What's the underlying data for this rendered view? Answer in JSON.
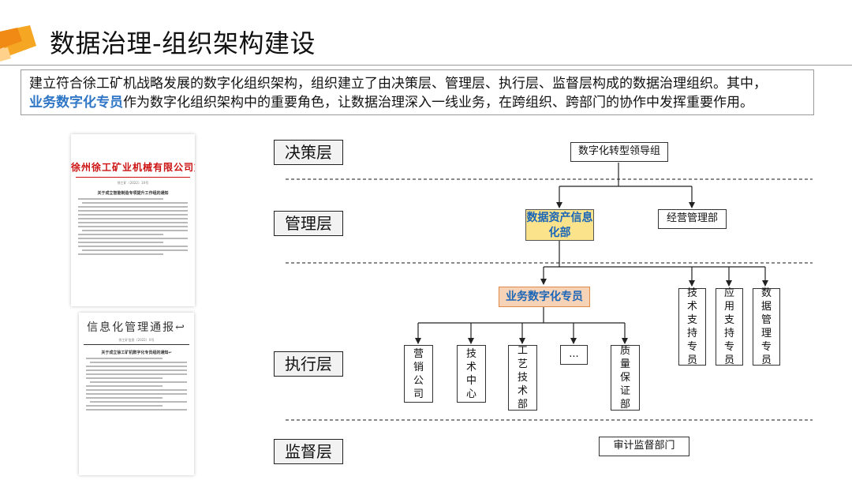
{
  "header": {
    "title": "数据治理-组织架构建设"
  },
  "intro": {
    "line1": "建立符合徐工矿机战略发展的数字化组织架构，组织建立了由决策层、管理层、执行层、监督层构成的数据治理组织。其中，",
    "highlight": "业务数字化专员",
    "line2": "作为数字化组织架构中的重要角色，让数据治理深入一线业务，在跨组织、跨部门的协作中发挥重要作用。"
  },
  "documents": {
    "doc1": {
      "heading": "徐州徐工矿业机械有限公司文件",
      "number": "徐工矿〔2022〕1X号",
      "subject": "关于成立智能制造专项提升工作组的通知"
    },
    "doc2": {
      "heading": "信息化管理通报↩",
      "number": "徐工矿信息〔2022〕X号",
      "subject": "关于成立徐工矿机数字化专员组的通知↩"
    }
  },
  "layers": {
    "decision": "决策层",
    "management": "管理层",
    "execution": "执行层",
    "supervision": "监督层"
  },
  "org": {
    "leader": "数字化转型领导组",
    "data_dept": "数据资产信息化部",
    "business_mgmt": "经营管理部",
    "specialist": "业务数字化专员",
    "units": [
      "营销公司",
      "技术中心",
      "工艺技术部",
      "...",
      "质量保证部"
    ],
    "support": [
      "技术支持专员",
      "应用支持专员",
      "数据管理专员"
    ],
    "audit": "审计监督部门"
  },
  "colors": {
    "highlight": "#2f77c6",
    "data_dept_fill": "#fbe38c",
    "specialist_fill": "#f6d2b6",
    "logo_orange": "#f5a623"
  }
}
